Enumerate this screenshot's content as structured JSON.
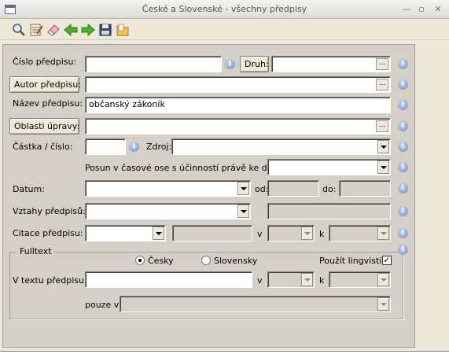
{
  "window": {
    "title": "České a Slovenské - všechny předpisy"
  },
  "toolbar": {
    "icons": [
      "search-icon",
      "edit-list-icon",
      "eraser-icon",
      "back-arrow-icon",
      "forward-arrow-icon",
      "save-icon",
      "folder-icon"
    ]
  },
  "form": {
    "cislo_label": "Číslo předpisu:",
    "druh_button": "Druh:",
    "autor_button": "Autor předpisu:",
    "nazev_label": "Název předpisu:",
    "nazev_value": "občanský zákoník",
    "oblasti_button": "Oblasti úpravy:",
    "castka_label": "Částka / číslo:",
    "zdroj_label": "Zdroj:",
    "posun_label": "Posun v časové ose s účinností právě ke dni:",
    "datum_label": "Datum:",
    "od_label": "od:",
    "do_label": "do:",
    "vztahy_label": "Vztahy předpisů:",
    "citace_label": "Citace předpisu:",
    "v_label": "v",
    "k_label": "k",
    "dots": "..."
  },
  "fulltext": {
    "legend": "Fulltext",
    "radio_cesky": "Česky",
    "radio_slovensky": "Slovensky",
    "selected": "Česky",
    "lingvistika_label": "Použít lingvistiku",
    "lingvistika_checked": true,
    "check_mark": "✓",
    "text_label": "V textu předpisu:",
    "v_label": "v",
    "k_label": "k",
    "pouze_label": "pouze v"
  },
  "info_glyph": "i"
}
